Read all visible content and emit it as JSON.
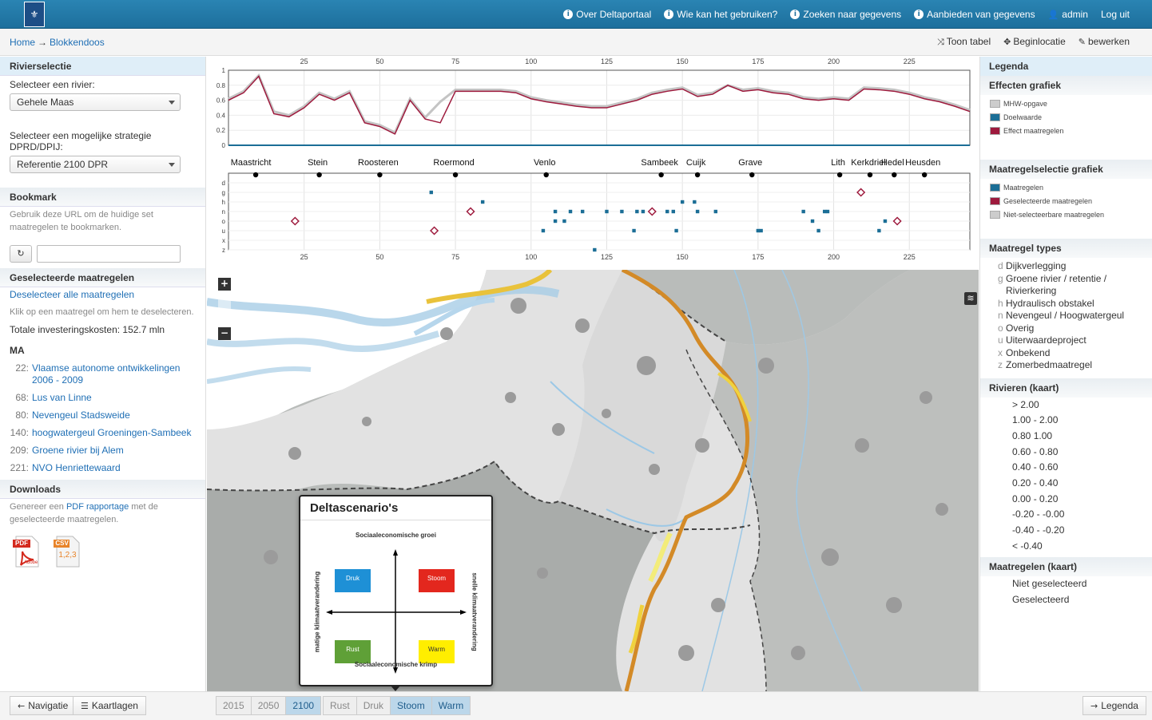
{
  "topbar": {
    "logo_symbol": "⚜",
    "links": [
      "Over Deltaportaal",
      "Wie kan het gebruiken?",
      "Zoeken naar gegevens",
      "Aanbieden van gegevens"
    ],
    "user": "admin",
    "logout": "Log uit"
  },
  "breadcrumb": {
    "home": "Home",
    "arrow": "→",
    "current": "Blokkendoos"
  },
  "subactions": {
    "table": "Toon tabel",
    "location": "Beginlocatie",
    "edit": "bewerken"
  },
  "left": {
    "river_title": "Rivierselectie",
    "river_label": "Selecteer een rivier:",
    "river_value": "Gehele Maas",
    "strategy_label": "Selecteer een mogelijke strategie DPRD/DPIJ:",
    "strategy_value": "Referentie 2100 DPR",
    "bookmark_title": "Bookmark",
    "bookmark_text": "Gebruik deze URL om de huidige set maatregelen te bookmarken.",
    "selected_title": "Geselecteerde maatregelen",
    "deselect_all": "Deselecteer alle maatregelen",
    "click_hint": "Klik op een maatregel om hem te deselecteren.",
    "total_cost": "Totale investeringskosten: 152.7 mln",
    "group": "MA",
    "measures": [
      {
        "num": "22:",
        "name": "Vlaamse autonome ontwikkelingen 2006 - 2009"
      },
      {
        "num": "68:",
        "name": "Lus van Linne"
      },
      {
        "num": "80:",
        "name": "Nevengeul Stadsweide"
      },
      {
        "num": "140:",
        "name": "hoogwatergeul Groeningen-Sambeek"
      },
      {
        "num": "209:",
        "name": "Groene rivier bij Alem"
      },
      {
        "num": "221:",
        "name": "NVO Henriettewaard"
      }
    ],
    "downloads_title": "Downloads",
    "downloads_pre": "Genereer een ",
    "downloads_link": "PDF rapportage",
    "downloads_post": " met de geselecteerde maatregelen.",
    "pdf_label": "PDF",
    "pdf_brand": "Adobe",
    "csv_label": "CSV",
    "csv_text": "1,2,3"
  },
  "chart": {
    "x_ticks": [
      "25",
      "50",
      "75",
      "100",
      "125",
      "150",
      "175",
      "200",
      "225"
    ],
    "y_ticks": [
      "1",
      "0.8",
      "0.6",
      "0.4",
      "0.2",
      "0"
    ],
    "type_ticks": [
      "d",
      "g",
      "h",
      "n",
      "o",
      "u",
      "x",
      "z"
    ],
    "cities": [
      {
        "name": "Maastricht",
        "km": 9
      },
      {
        "name": "Stein",
        "km": 30
      },
      {
        "name": "Roosteren",
        "km": 50
      },
      {
        "name": "Roermond",
        "km": 75
      },
      {
        "name": "Venlo",
        "km": 105
      },
      {
        "name": "Sambeek",
        "km": 143
      },
      {
        "name": "Cuijk",
        "km": 155
      },
      {
        "name": "Grave",
        "km": 173
      },
      {
        "name": "Lith",
        "km": 202
      },
      {
        "name": "Kerkdriel",
        "km": 212
      },
      {
        "name": "Hedel",
        "km": 220
      },
      {
        "name": "Heusden",
        "km": 230
      }
    ]
  },
  "chart_data": {
    "type": "line",
    "x": [
      0,
      5,
      10,
      15,
      20,
      25,
      30,
      35,
      40,
      45,
      50,
      55,
      60,
      65,
      70,
      75,
      80,
      85,
      90,
      95,
      100,
      105,
      110,
      115,
      120,
      125,
      130,
      135,
      140,
      145,
      150,
      155,
      160,
      165,
      170,
      175,
      180,
      185,
      190,
      195,
      200,
      205,
      210,
      215,
      220,
      225,
      230,
      235,
      240,
      245
    ],
    "series": [
      {
        "name": "Effect maatregelen",
        "values": [
          0.6,
          0.7,
          0.92,
          0.42,
          0.38,
          0.5,
          0.68,
          0.6,
          0.7,
          0.3,
          0.25,
          0.15,
          0.6,
          0.35,
          0.3,
          0.72,
          0.72,
          0.72,
          0.72,
          0.7,
          0.62,
          0.58,
          0.55,
          0.52,
          0.5,
          0.5,
          0.55,
          0.6,
          0.68,
          0.72,
          0.75,
          0.65,
          0.68,
          0.8,
          0.72,
          0.74,
          0.7,
          0.68,
          0.62,
          0.6,
          0.62,
          0.6,
          0.75,
          0.74,
          0.72,
          0.68,
          0.62,
          0.58,
          0.52,
          0.45
        ]
      },
      {
        "name": "MHW-opgave",
        "values": [
          0.62,
          0.72,
          0.93,
          0.45,
          0.4,
          0.52,
          0.7,
          0.62,
          0.72,
          0.32,
          0.27,
          0.17,
          0.62,
          0.37,
          0.58,
          0.74,
          0.74,
          0.74,
          0.74,
          0.72,
          0.64,
          0.6,
          0.57,
          0.54,
          0.52,
          0.52,
          0.57,
          0.62,
          0.7,
          0.74,
          0.77,
          0.67,
          0.7,
          0.8,
          0.74,
          0.76,
          0.72,
          0.7,
          0.64,
          0.62,
          0.64,
          0.62,
          0.77,
          0.76,
          0.74,
          0.7,
          0.64,
          0.6,
          0.54,
          0.47
        ]
      }
    ],
    "ylim": [
      0,
      1
    ],
    "xlim": [
      0,
      245
    ],
    "measures": [
      {
        "km": 22,
        "type": "o",
        "selected": true
      },
      {
        "km": 67,
        "type": "g",
        "selected": false
      },
      {
        "km": 68,
        "type": "u",
        "selected": true
      },
      {
        "km": 80,
        "type": "n",
        "selected": true
      },
      {
        "km": 84,
        "type": "h",
        "selected": false
      },
      {
        "km": 104,
        "type": "u",
        "selected": false
      },
      {
        "km": 108,
        "type": "n",
        "selected": false
      },
      {
        "km": 108,
        "type": "o",
        "selected": false
      },
      {
        "km": 111,
        "type": "o",
        "selected": false
      },
      {
        "km": 113,
        "type": "n",
        "selected": false
      },
      {
        "km": 117,
        "type": "n",
        "selected": false
      },
      {
        "km": 121,
        "type": "z",
        "selected": false
      },
      {
        "km": 125,
        "type": "n",
        "selected": false
      },
      {
        "km": 130,
        "type": "n",
        "selected": false
      },
      {
        "km": 134,
        "type": "u",
        "selected": false
      },
      {
        "km": 135,
        "type": "n",
        "selected": false
      },
      {
        "km": 137,
        "type": "n",
        "selected": false
      },
      {
        "km": 140,
        "type": "n",
        "selected": true
      },
      {
        "km": 145,
        "type": "n",
        "selected": false
      },
      {
        "km": 147,
        "type": "n",
        "selected": false
      },
      {
        "km": 148,
        "type": "u",
        "selected": false
      },
      {
        "km": 150,
        "type": "h",
        "selected": false
      },
      {
        "km": 154,
        "type": "h",
        "selected": false
      },
      {
        "km": 155,
        "type": "n",
        "selected": false
      },
      {
        "km": 161,
        "type": "n",
        "selected": false
      },
      {
        "km": 175,
        "type": "u",
        "selected": false
      },
      {
        "km": 176,
        "type": "u",
        "selected": false
      },
      {
        "km": 190,
        "type": "n",
        "selected": false
      },
      {
        "km": 193,
        "type": "o",
        "selected": false
      },
      {
        "km": 195,
        "type": "u",
        "selected": false
      },
      {
        "km": 197,
        "type": "n",
        "selected": false
      },
      {
        "km": 198,
        "type": "n",
        "selected": false
      },
      {
        "km": 209,
        "type": "g",
        "selected": true
      },
      {
        "km": 215,
        "type": "u",
        "selected": false
      },
      {
        "km": 217,
        "type": "o",
        "selected": false
      },
      {
        "km": 221,
        "type": "o",
        "selected": true
      }
    ]
  },
  "popup": {
    "title": "Deltascenario's",
    "top_axis": "Sociaaleconomische groei",
    "bottom_axis": "Sociaaleconomische krimp",
    "left_axis": "matige klimaatverandering",
    "right_axis": "snelle klimaatverandering",
    "q_druk": "Druk",
    "q_stoom": "Stoom",
    "q_rust": "Rust",
    "q_warm": "Warm"
  },
  "map": {
    "zoom_in": "+",
    "zoom_out": "−",
    "layers_icon": "≋"
  },
  "right": {
    "title": "Legenda",
    "effects_title": "Effecten grafiek",
    "effects": [
      {
        "label": "MHW-opgave",
        "color": "#cccccc"
      },
      {
        "label": "Doelwaarde",
        "color": "#1b6e96"
      },
      {
        "label": "Effect maatregelen",
        "color": "#9e1a3d"
      }
    ],
    "selection_title": "Maatregelselectie grafiek",
    "selection": [
      {
        "label": "Maatregelen",
        "color": "#1b6e96"
      },
      {
        "label": "Geselecteerde maatregelen",
        "color": "#9e1a3d"
      },
      {
        "label": "Niet-selecteerbare maatregelen",
        "color": "#cccccc"
      }
    ],
    "types_title": "Maatregel types",
    "types": [
      {
        "k": "d",
        "label": "Dijkverlegging"
      },
      {
        "k": "g",
        "label": "Groene rivier / retentie / Rivierkering"
      },
      {
        "k": "h",
        "label": "Hydraulisch obstakel"
      },
      {
        "k": "n",
        "label": "Nevengeul / Hoogwatergeul"
      },
      {
        "k": "o",
        "label": "Overig"
      },
      {
        "k": "u",
        "label": "Uiterwaardeproject"
      },
      {
        "k": "x",
        "label": "Onbekend"
      },
      {
        "k": "z",
        "label": "Zomerbedmaatregel"
      }
    ],
    "rivers_title": "Rivieren (kaart)",
    "rivers": [
      "> 2.00",
      "1.00 - 2.00",
      "0.80 1.00",
      "0.60 - 0.80",
      "0.40 - 0.60",
      "0.20 - 0.40",
      "0.00 - 0.20",
      "-0.20 - -0.00",
      "-0.40 - -0.20",
      "< -0.40"
    ],
    "map_measures_title": "Maatregelen (kaart)",
    "map_measures": [
      "Niet geselecteerd",
      "Geselecteerd"
    ]
  },
  "bottom": {
    "nav": "Navigatie",
    "layers": "Kaartlagen",
    "years": [
      "2015",
      "2050",
      "2100"
    ],
    "active_year": "2100",
    "scenarios": [
      "Rust",
      "Druk",
      "Stoom",
      "Warm"
    ],
    "active_scenarios": [
      "Stoom",
      "Warm"
    ],
    "legend": "Legenda"
  }
}
